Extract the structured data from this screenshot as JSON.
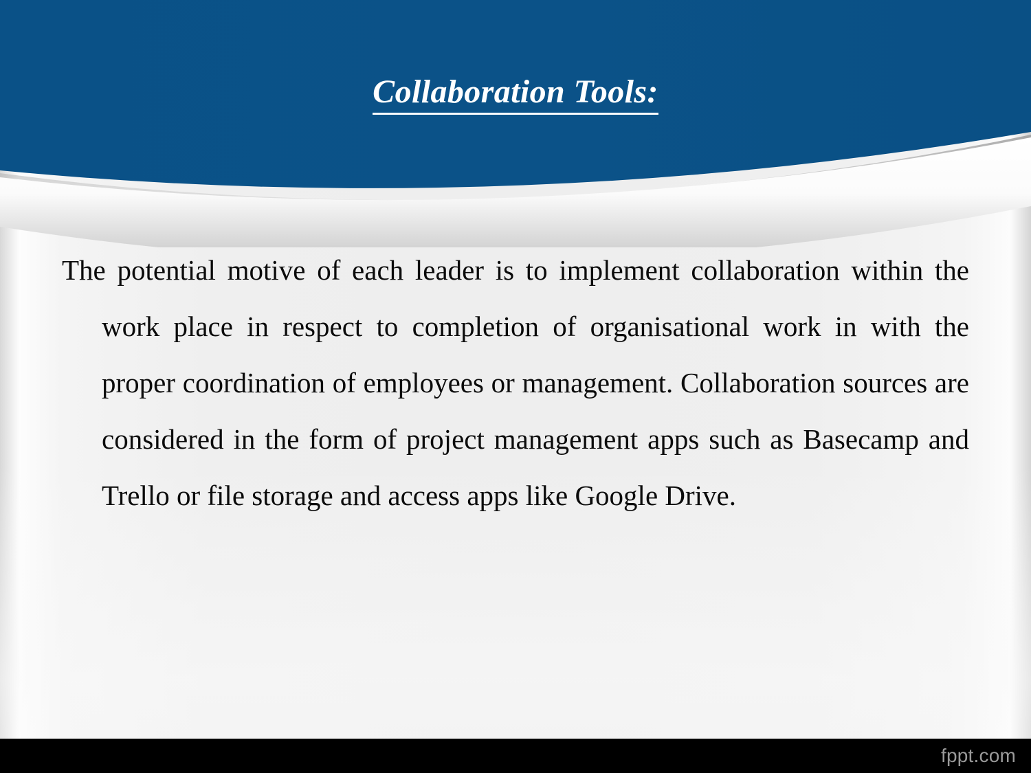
{
  "slide": {
    "title": "Collaboration Tools:",
    "body_text": "The potential motive of each leader is to implement collaboration within the work place in respect to completion of organisational work in with the proper coordination of employees or management. Collaboration sources are considered in the form of project management apps such as Basecamp and Trello or file storage and access apps like Google Drive.",
    "body_lines": [
      "The potential motive of each leader is to implement collaboration",
      "within the work place in respect to completion of organisational",
      "work in with the proper coordination of employees or management.",
      "Collaboration sources are considered in the form of project",
      "management apps such as Basecamp and Trello or file storage and",
      "access apps like Google Drive."
    ]
  },
  "footer": {
    "watermark": "fppt.com"
  },
  "colors": {
    "header_blue": "#0b5288",
    "header_blue_dark": "#094a7c",
    "title_text": "#ffffff",
    "body_text": "#0b0b0b",
    "body_background": "#efefef",
    "footer_background": "#000000",
    "footer_watermark_text": "#9a9a9a",
    "curve_highlight": "#ffffff",
    "curve_shadow": "#b9b9b9"
  }
}
